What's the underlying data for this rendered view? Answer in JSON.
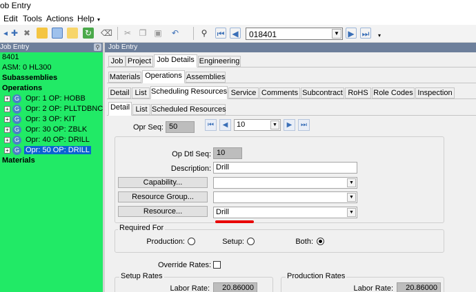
{
  "window": {
    "title": "ob Entry"
  },
  "menu": {
    "items": [
      "Edit",
      "Tools",
      "Actions",
      "Help"
    ],
    "caret": "▾"
  },
  "toolbar": {
    "job_number": "018401",
    "icons": [
      "pin-icon",
      "new-icon",
      "delete-icon",
      "open-folder-icon",
      "save-icon",
      "refresh-icon",
      "print-icon",
      "clear-icon",
      "cut-icon",
      "copy-icon",
      "paste-icon",
      "undo-icon",
      "search-icon",
      "first-record-icon",
      "previous-record-icon",
      "next-record-icon",
      "last-record-icon"
    ]
  },
  "tree": {
    "header": "Job Entry",
    "root": "8401",
    "asm": "ASM: 0 HL300",
    "subassemblies": "Subassemblies",
    "operations_label": "Operations",
    "operations": [
      {
        "label": "Opr: 1 OP: HOBB",
        "selected": false
      },
      {
        "label": "Opr: 2 OP: PLLTDBNC",
        "selected": false
      },
      {
        "label": "Opr: 3 OP: KIT",
        "selected": false
      },
      {
        "label": "Opr: 30 OP: ZBLK",
        "selected": false
      },
      {
        "label": "Opr: 40 OP: DRILL",
        "selected": false
      },
      {
        "label": "Opr: 50 OP: DRILL",
        "selected": true
      }
    ],
    "materials": "Materials"
  },
  "panel": {
    "header": "Job Entry",
    "tabs_l1": [
      "Job",
      "Project",
      "Job Details",
      "Engineering"
    ],
    "tabs_l2": [
      "Materials",
      "Operations",
      "Assemblies"
    ],
    "tabs_l3": [
      "Detail",
      "List",
      "Scheduling Resources",
      "Service",
      "Comments",
      "Subcontract",
      "RoHS",
      "Role Codes",
      "Inspection"
    ],
    "tabs_l4": [
      "Detail",
      "List",
      "Scheduled Resources"
    ]
  },
  "form": {
    "opr_seq_label": "Opr Seq:",
    "opr_seq_value": "50",
    "resource_seq": "10",
    "op_dtl_seq_label": "Op Dtl Seq:",
    "op_dtl_seq_value": "10",
    "description_label": "Description:",
    "description_value": "Drill",
    "capability_button": "Capability...",
    "capability_value": "",
    "resource_group_button": "Resource Group...",
    "resource_group_value": "",
    "resource_button": "Resource...",
    "resource_value": "Drill",
    "required_for_label": "Required For",
    "production_label": "Production:",
    "setup_label": "Setup:",
    "both_label": "Both:",
    "required_for_selected": "Both",
    "override_rates_label": "Override Rates:",
    "override_rates_checked": false,
    "setup_rates_label": "Setup Rates",
    "production_rates_label": "Production Rates",
    "setup_labor_rate_label": "Labor Rate:",
    "setup_labor_rate_value": "20.86000",
    "production_labor_rate_label": "Labor Rate:",
    "production_labor_rate_value": "20.86000"
  },
  "colors": {
    "tree_background": "#21ea66",
    "header_bar": "#6d7f9b",
    "selection": "#0a64d2",
    "annotation_underline": "#e80000"
  }
}
